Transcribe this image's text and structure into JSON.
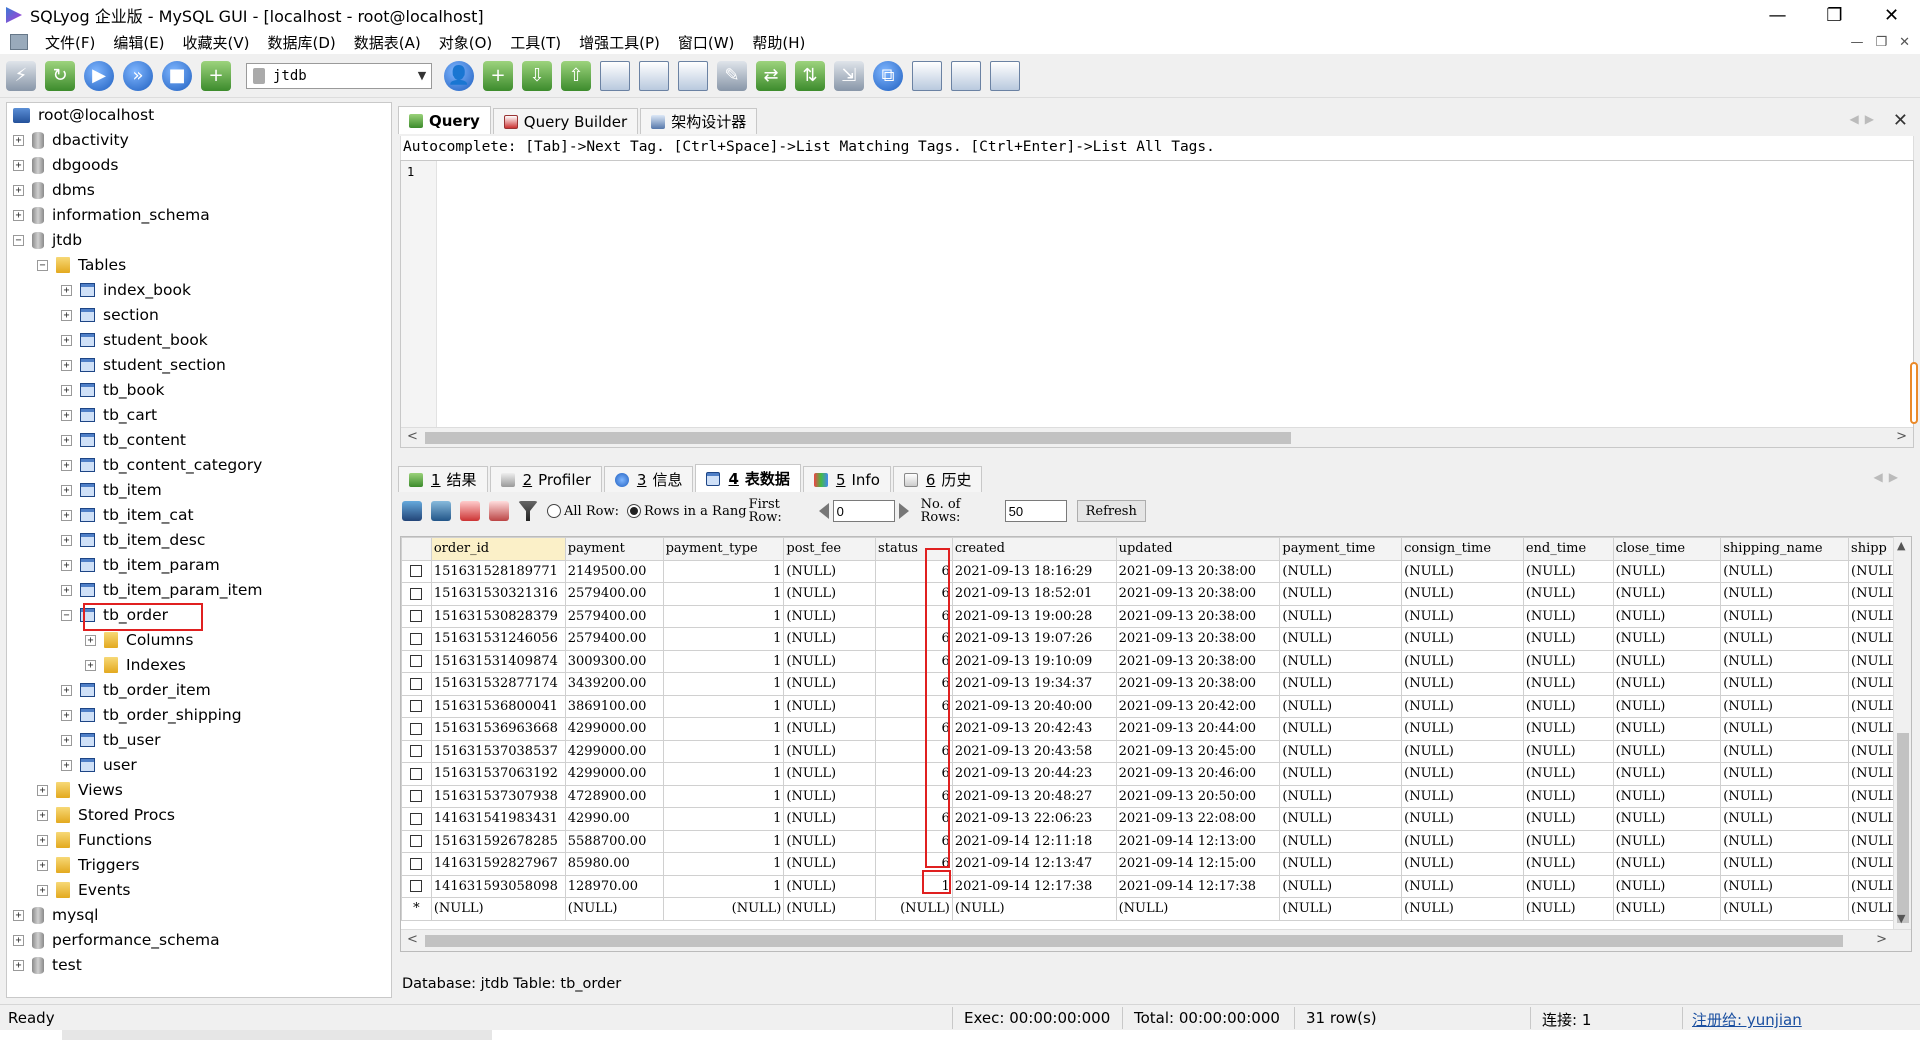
{
  "window": {
    "title": "SQLyog 企业版 - MySQL GUI - [localhost - root@localhost]",
    "minimize": "—",
    "maximize": "❐",
    "close": "✕"
  },
  "menu": [
    "文件(F)",
    "编辑(E)",
    "收藏夹(V)",
    "数据库(D)",
    "数据表(A)",
    "对象(O)",
    "工具(T)",
    "增强工具(P)",
    "窗口(W)",
    "帮助(H)"
  ],
  "toolbar": {
    "database_selected": "jtdb"
  },
  "tree": {
    "root": "root@localhost",
    "items": [
      {
        "label": "dbactivity",
        "type": "db",
        "level": 1,
        "exp": "+"
      },
      {
        "label": "dbgoods",
        "type": "db",
        "level": 1,
        "exp": "+"
      },
      {
        "label": "dbms",
        "type": "db",
        "level": 1,
        "exp": "+"
      },
      {
        "label": "information_schema",
        "type": "db",
        "level": 1,
        "exp": "+"
      },
      {
        "label": "jtdb",
        "type": "db",
        "level": 1,
        "exp": "−"
      },
      {
        "label": "Tables",
        "type": "folder",
        "level": 2,
        "exp": "−"
      },
      {
        "label": "index_book",
        "type": "table",
        "level": 3,
        "exp": "+"
      },
      {
        "label": "section",
        "type": "table",
        "level": 3,
        "exp": "+"
      },
      {
        "label": "student_book",
        "type": "table",
        "level": 3,
        "exp": "+"
      },
      {
        "label": "student_section",
        "type": "table",
        "level": 3,
        "exp": "+"
      },
      {
        "label": "tb_book",
        "type": "table",
        "level": 3,
        "exp": "+"
      },
      {
        "label": "tb_cart",
        "type": "table",
        "level": 3,
        "exp": "+"
      },
      {
        "label": "tb_content",
        "type": "table",
        "level": 3,
        "exp": "+"
      },
      {
        "label": "tb_content_category",
        "type": "table",
        "level": 3,
        "exp": "+"
      },
      {
        "label": "tb_item",
        "type": "table",
        "level": 3,
        "exp": "+"
      },
      {
        "label": "tb_item_cat",
        "type": "table",
        "level": 3,
        "exp": "+"
      },
      {
        "label": "tb_item_desc",
        "type": "table",
        "level": 3,
        "exp": "+"
      },
      {
        "label": "tb_item_param",
        "type": "table",
        "level": 3,
        "exp": "+"
      },
      {
        "label": "tb_item_param_item",
        "type": "table",
        "level": 3,
        "exp": "+"
      },
      {
        "label": "tb_order",
        "type": "table",
        "level": 3,
        "exp": "−"
      },
      {
        "label": "Columns",
        "type": "folder",
        "level": 4,
        "exp": "+"
      },
      {
        "label": "Indexes",
        "type": "folder",
        "level": 4,
        "exp": "+"
      },
      {
        "label": "tb_order_item",
        "type": "table",
        "level": 3,
        "exp": "+"
      },
      {
        "label": "tb_order_shipping",
        "type": "table",
        "level": 3,
        "exp": "+"
      },
      {
        "label": "tb_user",
        "type": "table",
        "level": 3,
        "exp": "+"
      },
      {
        "label": "user",
        "type": "table",
        "level": 3,
        "exp": "+"
      },
      {
        "label": "Views",
        "type": "folder",
        "level": 2,
        "exp": "+"
      },
      {
        "label": "Stored Procs",
        "type": "folder",
        "level": 2,
        "exp": "+"
      },
      {
        "label": "Functions",
        "type": "folder",
        "level": 2,
        "exp": "+"
      },
      {
        "label": "Triggers",
        "type": "folder",
        "level": 2,
        "exp": "+"
      },
      {
        "label": "Events",
        "type": "folder",
        "level": 2,
        "exp": "+"
      },
      {
        "label": "mysql",
        "type": "db",
        "level": 1,
        "exp": "+"
      },
      {
        "label": "performance_schema",
        "type": "db",
        "level": 1,
        "exp": "+"
      },
      {
        "label": "test",
        "type": "db",
        "level": 1,
        "exp": "+"
      }
    ]
  },
  "query_tabs": [
    {
      "label": "Query",
      "active": true
    },
    {
      "label": "Query Builder",
      "active": false
    },
    {
      "label": "架构设计器",
      "active": false
    }
  ],
  "autocomplete_hint": "Autocomplete: [Tab]->Next Tag. [Ctrl+Space]->List Matching Tags. [Ctrl+Enter]->List All Tags.",
  "editor": {
    "line_number": "1"
  },
  "result_tabs": [
    {
      "num": "1",
      "label": "结果",
      "active": false
    },
    {
      "num": "2",
      "label": "Profiler",
      "active": false
    },
    {
      "num": "3",
      "label": "信息",
      "active": false
    },
    {
      "num": "4",
      "label": "表数据",
      "active": true
    },
    {
      "num": "5",
      "label": "Info",
      "active": false
    },
    {
      "num": "6",
      "label": "历史",
      "active": false
    }
  ],
  "grid_toolbar": {
    "all_rows": "All Row:",
    "rows_in_range": "Rows in a Rang",
    "first_row_label": "First Row:",
    "first_row_value": "0",
    "num_rows_label": "No. of Rows:",
    "num_rows_value": "50",
    "refresh": "Refresh"
  },
  "grid": {
    "columns": [
      "order_id",
      "payment",
      "payment_type",
      "post_fee",
      "status",
      "created",
      "updated",
      "payment_time",
      "consign_time",
      "end_time",
      "close_time",
      "shipping_name",
      "shipp"
    ],
    "rows": [
      [
        "151631528189771",
        "2149500.00",
        "1",
        "(NULL)",
        "6",
        "2021-09-13 18:16:29",
        "2021-09-13 20:38:00",
        "(NULL)",
        "(NULL)",
        "(NULL)",
        "(NULL)",
        "(NULL)",
        "(NULL"
      ],
      [
        "151631530321316",
        "2579400.00",
        "1",
        "(NULL)",
        "6",
        "2021-09-13 18:52:01",
        "2021-09-13 20:38:00",
        "(NULL)",
        "(NULL)",
        "(NULL)",
        "(NULL)",
        "(NULL)",
        "(NULL"
      ],
      [
        "151631530828379",
        "2579400.00",
        "1",
        "(NULL)",
        "6",
        "2021-09-13 19:00:28",
        "2021-09-13 20:38:00",
        "(NULL)",
        "(NULL)",
        "(NULL)",
        "(NULL)",
        "(NULL)",
        "(NULL"
      ],
      [
        "151631531246056",
        "2579400.00",
        "1",
        "(NULL)",
        "6",
        "2021-09-13 19:07:26",
        "2021-09-13 20:38:00",
        "(NULL)",
        "(NULL)",
        "(NULL)",
        "(NULL)",
        "(NULL)",
        "(NULL"
      ],
      [
        "151631531409874",
        "3009300.00",
        "1",
        "(NULL)",
        "6",
        "2021-09-13 19:10:09",
        "2021-09-13 20:38:00",
        "(NULL)",
        "(NULL)",
        "(NULL)",
        "(NULL)",
        "(NULL)",
        "(NULL"
      ],
      [
        "151631532877174",
        "3439200.00",
        "1",
        "(NULL)",
        "6",
        "2021-09-13 19:34:37",
        "2021-09-13 20:38:00",
        "(NULL)",
        "(NULL)",
        "(NULL)",
        "(NULL)",
        "(NULL)",
        "(NULL"
      ],
      [
        "151631536800041",
        "3869100.00",
        "1",
        "(NULL)",
        "6",
        "2021-09-13 20:40:00",
        "2021-09-13 20:42:00",
        "(NULL)",
        "(NULL)",
        "(NULL)",
        "(NULL)",
        "(NULL)",
        "(NULL"
      ],
      [
        "151631536963668",
        "4299000.00",
        "1",
        "(NULL)",
        "6",
        "2021-09-13 20:42:43",
        "2021-09-13 20:44:00",
        "(NULL)",
        "(NULL)",
        "(NULL)",
        "(NULL)",
        "(NULL)",
        "(NULL"
      ],
      [
        "151631537038537",
        "4299000.00",
        "1",
        "(NULL)",
        "6",
        "2021-09-13 20:43:58",
        "2021-09-13 20:45:00",
        "(NULL)",
        "(NULL)",
        "(NULL)",
        "(NULL)",
        "(NULL)",
        "(NULL"
      ],
      [
        "151631537063192",
        "4299000.00",
        "1",
        "(NULL)",
        "6",
        "2021-09-13 20:44:23",
        "2021-09-13 20:46:00",
        "(NULL)",
        "(NULL)",
        "(NULL)",
        "(NULL)",
        "(NULL)",
        "(NULL"
      ],
      [
        "151631537307938",
        "4728900.00",
        "1",
        "(NULL)",
        "6",
        "2021-09-13 20:48:27",
        "2021-09-13 20:50:00",
        "(NULL)",
        "(NULL)",
        "(NULL)",
        "(NULL)",
        "(NULL)",
        "(NULL"
      ],
      [
        "141631541983431",
        "42990.00",
        "1",
        "(NULL)",
        "6",
        "2021-09-13 22:06:23",
        "2021-09-13 22:08:00",
        "(NULL)",
        "(NULL)",
        "(NULL)",
        "(NULL)",
        "(NULL)",
        "(NULL"
      ],
      [
        "151631592678285",
        "5588700.00",
        "1",
        "(NULL)",
        "6",
        "2021-09-14 12:11:18",
        "2021-09-14 12:13:00",
        "(NULL)",
        "(NULL)",
        "(NULL)",
        "(NULL)",
        "(NULL)",
        "(NULL"
      ],
      [
        "141631592827967",
        "85980.00",
        "1",
        "(NULL)",
        "6",
        "2021-09-14 12:13:47",
        "2021-09-14 12:15:00",
        "(NULL)",
        "(NULL)",
        "(NULL)",
        "(NULL)",
        "(NULL)",
        "(NULL"
      ],
      [
        "141631593058098",
        "128970.00",
        "1",
        "(NULL)",
        "1",
        "2021-09-14 12:17:38",
        "2021-09-14 12:17:38",
        "(NULL)",
        "(NULL)",
        "(NULL)",
        "(NULL)",
        "(NULL)",
        "(NULL"
      ]
    ],
    "new_row_marker": "*",
    "new_row": [
      "(NULL)",
      "(NULL)",
      "(NULL)",
      "(NULL)",
      "(NULL)",
      "(NULL)",
      "(NULL)",
      "(NULL)",
      "(NULL)",
      "(NULL)",
      "(NULL)",
      "(NULL)",
      "(NULL"
    ]
  },
  "info_bar": "Database: jtdb  Table: tb_order",
  "statusbar": {
    "ready": "Ready",
    "exec": "Exec: 00:00:00:000",
    "total": "Total: 00:00:00:000",
    "rows": "31 row(s)",
    "connection": "连接: 1",
    "registered": "注册给: yunjian"
  }
}
